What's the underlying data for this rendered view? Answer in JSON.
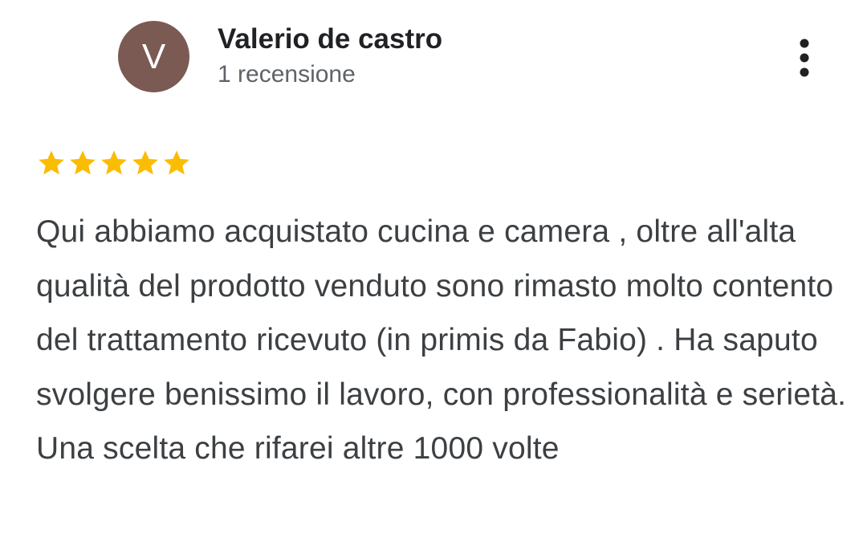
{
  "reviewer": {
    "initial": "V",
    "name": "Valerio de castro",
    "review_count": "1 recensione",
    "avatar_color": "#7b5a53"
  },
  "menu": {
    "icon": "more-vert-icon"
  },
  "rating": {
    "stars": 5,
    "max": 5,
    "star_color": "#fbbc04"
  },
  "review": {
    "text": "Qui abbiamo acquistato cucina e camera , oltre all'alta qualità del prodotto venduto sono rimasto molto contento del trattamento ricevuto (in primis da Fabio) . Ha saputo svolgere benissimo il lavoro, con professionalità e serietà. Una scelta che rifarei altre 1000 volte"
  }
}
